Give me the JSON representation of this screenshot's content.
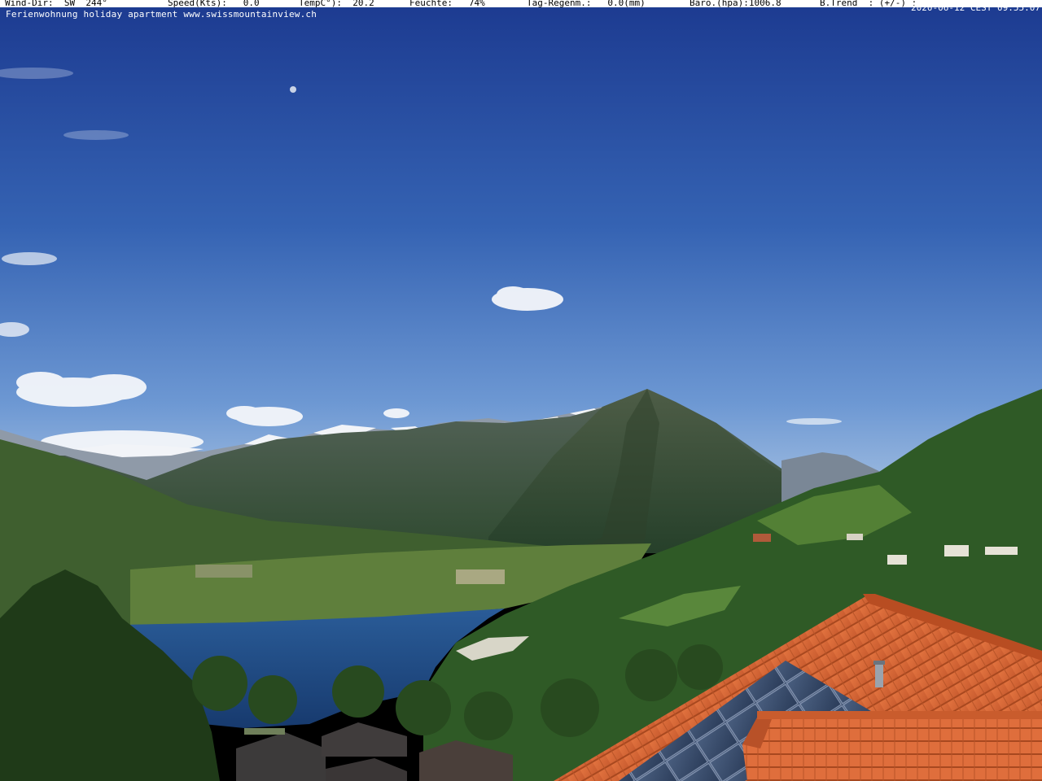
{
  "status_bar": {
    "wind_dir": "Wind-Dir:  SW  244°",
    "speed": "Speed(Kts):   0.0",
    "temp": "TempC°):  20.2",
    "humidity": "Feuchte:   74%",
    "rain": "Tag-Regenm.:   0.0(mm)",
    "baro": "Baro.(hpa):1006.8",
    "trend": "B.Trend  : (+/-) :"
  },
  "caption": "Ferienwohnung holiday apartment www.swissmountainview.ch",
  "timestamp": "2020-06-12 CEST 09:55:07",
  "colors": {
    "sky_top": "#1f3f96",
    "sky_horizon": "#7fa6d8",
    "lake": "#1e4a86",
    "roof_tile": "#d9683a",
    "solar_panel": "#3a4d6e"
  }
}
